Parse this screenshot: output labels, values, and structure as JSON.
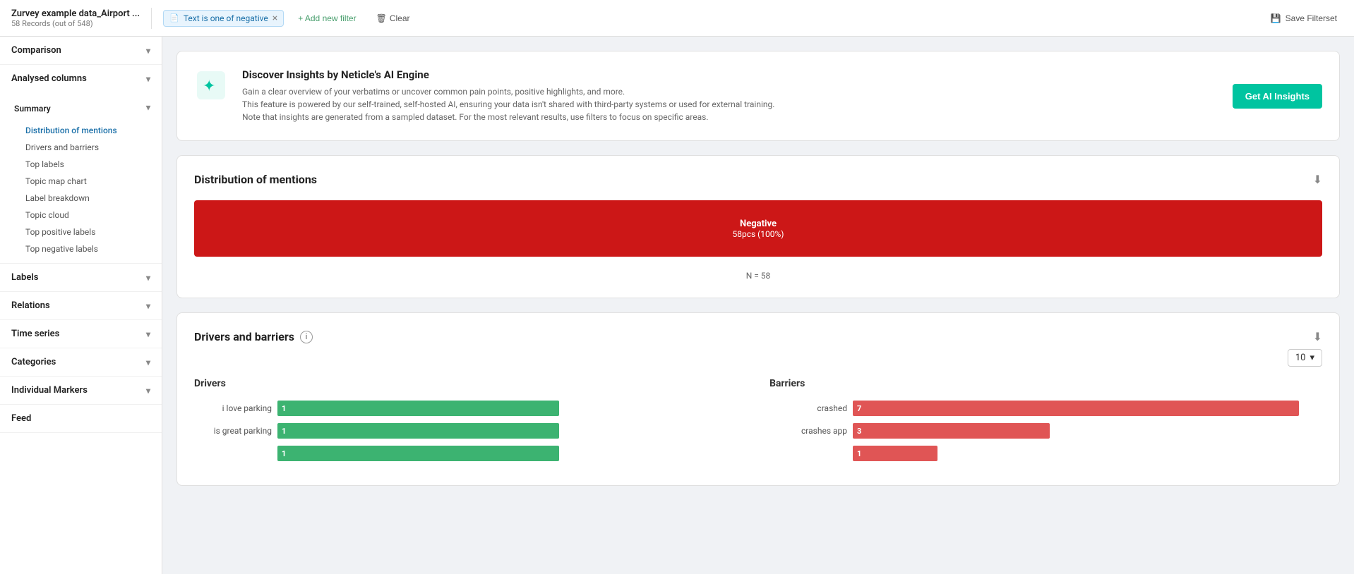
{
  "topbar": {
    "title": "Zurvey example data_Airport ...",
    "subtitle": "58 Records (out of 548)",
    "filter": {
      "icon": "📄",
      "text": "Text is one of negative",
      "remove_label": "×"
    },
    "add_filter_label": "+ Add new filter",
    "clear_label": "Clear",
    "save_filterset_label": "Save Filterset"
  },
  "sidebar": {
    "comparison_label": "Comparison",
    "analysed_columns_label": "Analysed columns",
    "summary_label": "Summary",
    "summary_items": [
      {
        "id": "distribution",
        "label": "Distribution of mentions",
        "active": true
      },
      {
        "id": "drivers",
        "label": "Drivers and barriers",
        "active": false
      },
      {
        "id": "top-labels",
        "label": "Top labels",
        "active": false
      },
      {
        "id": "topic-map",
        "label": "Topic map chart",
        "active": false
      },
      {
        "id": "label-breakdown",
        "label": "Label breakdown",
        "active": false
      },
      {
        "id": "topic-cloud",
        "label": "Topic cloud",
        "active": false
      },
      {
        "id": "top-positive",
        "label": "Top positive labels",
        "active": false
      },
      {
        "id": "top-negative",
        "label": "Top negative labels",
        "active": false
      }
    ],
    "labels_label": "Labels",
    "relations_label": "Relations",
    "time_series_label": "Time series",
    "categories_label": "Categories",
    "individual_markers_label": "Individual Markers",
    "feed_label": "Feed"
  },
  "ai_insights": {
    "title": "Discover Insights by Neticle's AI Engine",
    "description_line1": "Gain a clear overview of your verbatims or uncover common pain points, positive highlights, and more.",
    "description_line2": "This feature is powered by our self-trained, self-hosted AI, ensuring your data isn't shared with third-party systems or used for external training.",
    "description_line3": "Note that insights are generated from a sampled dataset. For the most relevant results, use filters to focus on specific areas.",
    "button_label": "Get AI Insights"
  },
  "distribution": {
    "title": "Distribution of mentions",
    "bar": {
      "label": "Negative",
      "count": "58pcs (100%)"
    },
    "n_label": "N = 58"
  },
  "drivers_barriers": {
    "title": "Drivers and barriers",
    "count_select": "10",
    "drivers_label": "Drivers",
    "barriers_label": "Barriers",
    "drivers": [
      {
        "label": "i love parking",
        "value": 1,
        "width_pct": 60
      },
      {
        "label": "is great parking",
        "value": 1,
        "width_pct": 60
      },
      {
        "label": "",
        "value": 1,
        "width_pct": 60
      }
    ],
    "barriers": [
      {
        "label": "crashed",
        "value": 7,
        "width_pct": 95
      },
      {
        "label": "crashes app",
        "value": 3,
        "width_pct": 42
      },
      {
        "label": "",
        "value": 1,
        "width_pct": 18
      }
    ]
  },
  "icons": {
    "chevron_down": "▾",
    "chevron_up": "▴",
    "download": "⬇",
    "info": "i",
    "plus": "+",
    "clear": "🗑",
    "save": "💾",
    "ai_wand": "✦"
  }
}
